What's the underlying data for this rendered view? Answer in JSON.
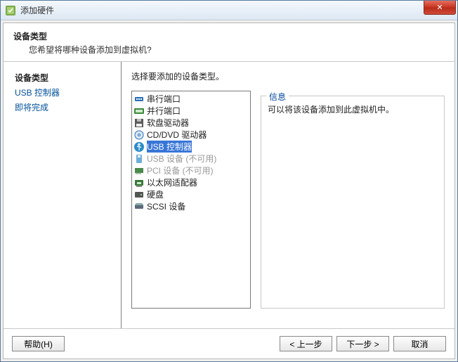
{
  "window": {
    "title": "添加硬件",
    "close_glyph": "✕"
  },
  "header": {
    "heading": "设备类型",
    "subheading": "您希望将哪种设备添加到虚拟机?"
  },
  "sidebar": {
    "steps": [
      {
        "label": "设备类型",
        "state": "current"
      },
      {
        "label": "USB 控制器",
        "state": "link"
      },
      {
        "label": "即将完成",
        "state": "link"
      }
    ]
  },
  "main": {
    "instruction": "选择要添加的设备类型。",
    "devices": [
      {
        "id": "serial-port",
        "label": "串行端口",
        "disabled": false,
        "selected": false,
        "icon": "serial"
      },
      {
        "id": "parallel-port",
        "label": "并行端口",
        "disabled": false,
        "selected": false,
        "icon": "parallel"
      },
      {
        "id": "floppy-drive",
        "label": "软盘驱动器",
        "disabled": false,
        "selected": false,
        "icon": "floppy"
      },
      {
        "id": "cd-dvd-drive",
        "label": "CD/DVD 驱动器",
        "disabled": false,
        "selected": false,
        "icon": "cd"
      },
      {
        "id": "usb-controller",
        "label": "USB 控制器",
        "disabled": false,
        "selected": true,
        "icon": "usb"
      },
      {
        "id": "usb-device",
        "label": "USB 设备 (不可用)",
        "disabled": true,
        "selected": false,
        "icon": "usb-dev"
      },
      {
        "id": "pci-device",
        "label": "PCI 设备 (不可用)",
        "disabled": true,
        "selected": false,
        "icon": "pci"
      },
      {
        "id": "ethernet-adapter",
        "label": "以太网适配器",
        "disabled": false,
        "selected": false,
        "icon": "nic"
      },
      {
        "id": "hard-disk",
        "label": "硬盘",
        "disabled": false,
        "selected": false,
        "icon": "hdd"
      },
      {
        "id": "scsi-device",
        "label": "SCSI 设备",
        "disabled": false,
        "selected": false,
        "icon": "scsi"
      }
    ],
    "info": {
      "legend": "信息",
      "text": "可以将该设备添加到此虚拟机中。"
    }
  },
  "footer": {
    "help": "帮助(H)",
    "back": "< 上一步",
    "next": "下一步 >",
    "cancel": "取消"
  },
  "icon_colors": {
    "serial": "#2a6fb7",
    "parallel": "#3a8a3a",
    "floppy": "#5a5a5a",
    "cd": "#2a6fb7",
    "usb": "#2a8cc8",
    "usb-dev": "#6faed8",
    "pci": "#4a8a4a",
    "nic": "#3a7a3a",
    "hdd": "#555555",
    "scsi": "#5a6a7a"
  }
}
